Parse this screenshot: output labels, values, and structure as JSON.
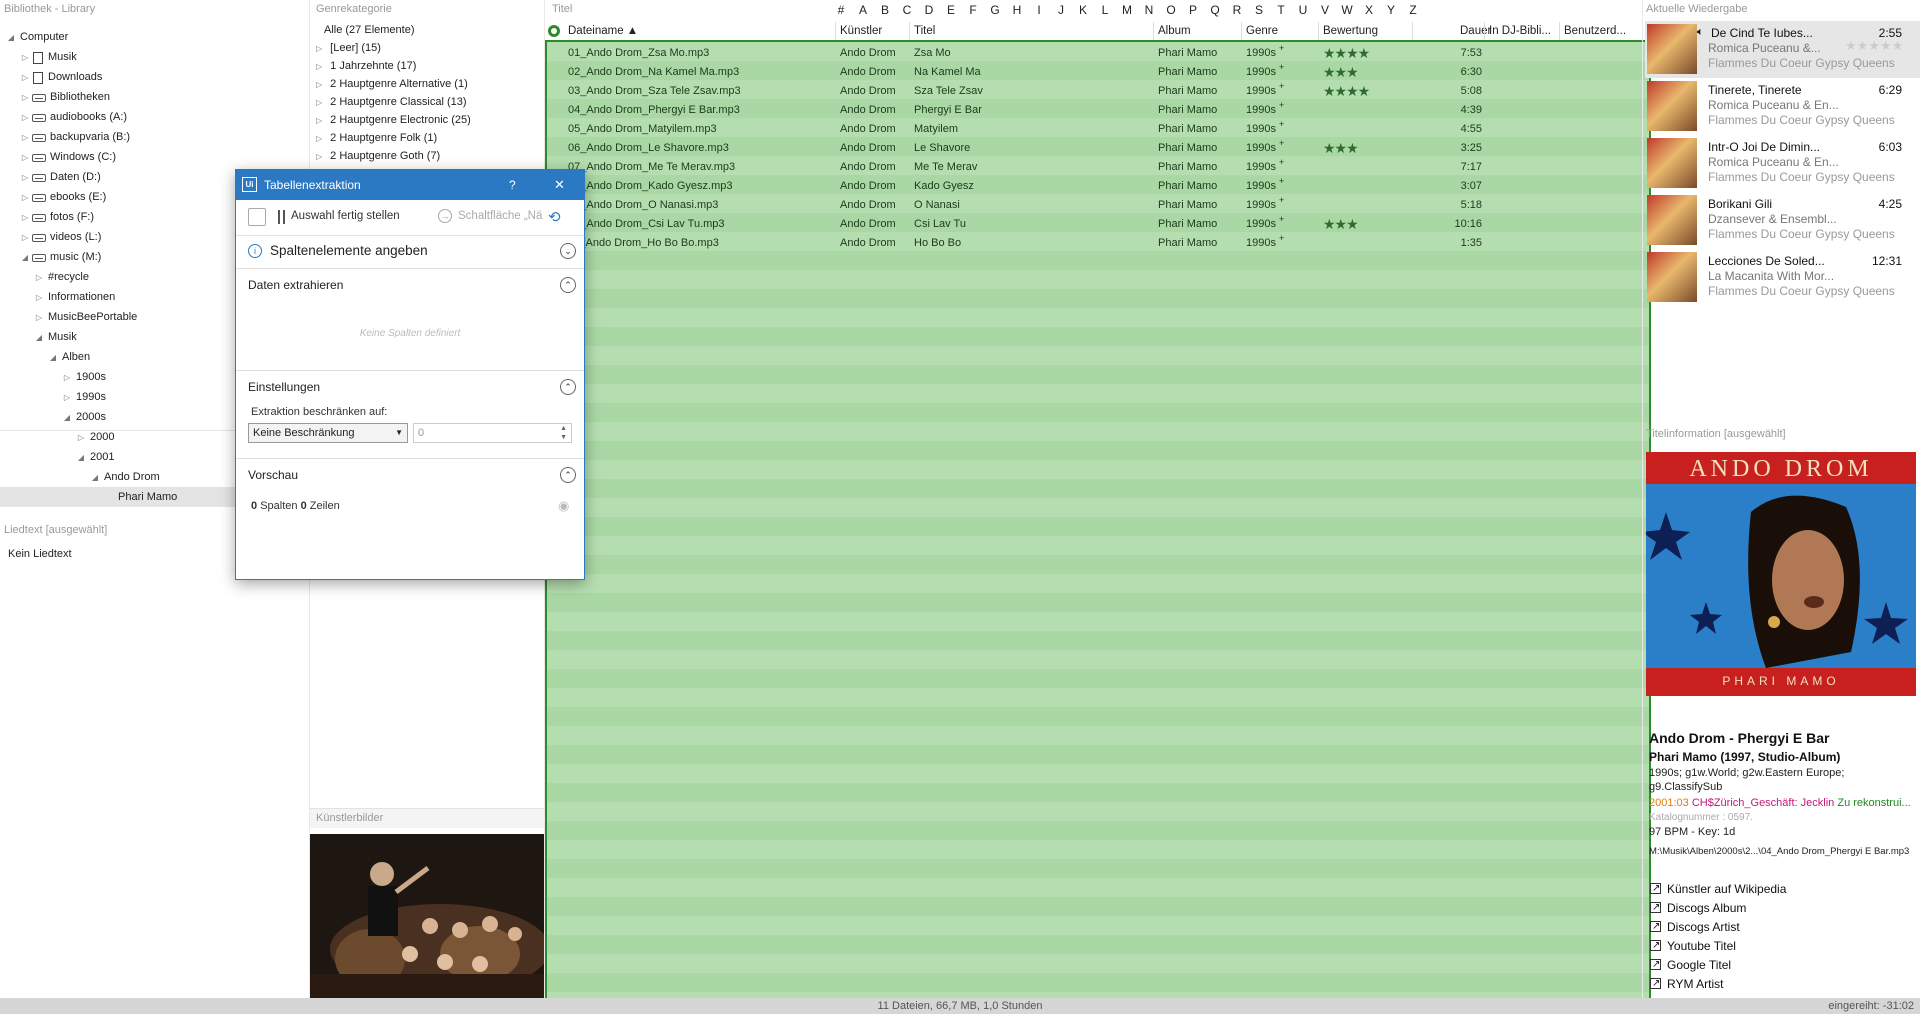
{
  "library": {
    "header": "Bibliothek - Library",
    "tree": [
      {
        "label": "Computer",
        "level": 0,
        "toggle": "◢",
        "icon": "none"
      },
      {
        "label": "Musik",
        "level": 1,
        "toggle": "▷",
        "icon": "folder"
      },
      {
        "label": "Downloads",
        "level": 1,
        "toggle": "▷",
        "icon": "folder"
      },
      {
        "label": "Bibliotheken",
        "level": 1,
        "toggle": "▷",
        "icon": "drive"
      },
      {
        "label": "audiobooks (A:)",
        "level": 1,
        "toggle": "▷",
        "icon": "drive"
      },
      {
        "label": "backupvaria (B:)",
        "level": 1,
        "toggle": "▷",
        "icon": "drive"
      },
      {
        "label": "Windows (C:)",
        "level": 1,
        "toggle": "▷",
        "icon": "drive"
      },
      {
        "label": "Daten (D:)",
        "level": 1,
        "toggle": "▷",
        "icon": "drive"
      },
      {
        "label": "ebooks (E:)",
        "level": 1,
        "toggle": "▷",
        "icon": "drive"
      },
      {
        "label": "fotos (F:)",
        "level": 1,
        "toggle": "▷",
        "icon": "drive"
      },
      {
        "label": "videos (L:)",
        "level": 1,
        "toggle": "▷",
        "icon": "drive"
      },
      {
        "label": "music (M:)",
        "level": 1,
        "toggle": "◢",
        "icon": "drive"
      },
      {
        "label": "#recycle",
        "level": 2,
        "toggle": "▷",
        "icon": "none"
      },
      {
        "label": "Informationen",
        "level": 2,
        "toggle": "▷",
        "icon": "none"
      },
      {
        "label": "MusicBeePortable",
        "level": 2,
        "toggle": "▷",
        "icon": "none"
      },
      {
        "label": "Musik",
        "level": 2,
        "toggle": "◢",
        "icon": "none"
      },
      {
        "label": "Alben",
        "level": 3,
        "toggle": "◢",
        "icon": "none"
      },
      {
        "label": "1900s",
        "level": 4,
        "toggle": "▷",
        "icon": "none"
      },
      {
        "label": "1990s",
        "level": 4,
        "toggle": "▷",
        "icon": "none"
      },
      {
        "label": "2000s",
        "level": 4,
        "toggle": "◢",
        "icon": "none"
      },
      {
        "label": "2000",
        "level": 5,
        "toggle": "▷",
        "icon": "none"
      },
      {
        "label": "2001",
        "level": 5,
        "toggle": "◢",
        "icon": "none"
      },
      {
        "label": "Ando Drom",
        "level": 6,
        "toggle": "◢",
        "icon": "none"
      },
      {
        "label": "Phari Mamo",
        "level": 7,
        "toggle": "",
        "icon": "none",
        "selected": true
      }
    ]
  },
  "lyrics": {
    "header": "Liedtext  [ausgewählt]",
    "text": "Kein Liedtext"
  },
  "genre": {
    "header": "Genrekategorie",
    "items": [
      {
        "label": "Alle  (27 Elemente)",
        "toggle": ""
      },
      {
        "label": "[Leer]  (15)",
        "toggle": "▷"
      },
      {
        "label": "1 Jahrzehnte  (17)",
        "toggle": "▷"
      },
      {
        "label": "2 Hauptgenre Alternative  (1)",
        "toggle": "▷"
      },
      {
        "label": "2 Hauptgenre Classical  (13)",
        "toggle": "▷"
      },
      {
        "label": "2 Hauptgenre Electronic  (25)",
        "toggle": "▷"
      },
      {
        "label": "2 Hauptgenre Folk  (1)",
        "toggle": "▷"
      },
      {
        "label": "2 Hauptgenre Goth  (7)",
        "toggle": "▷"
      }
    ]
  },
  "artist_images": {
    "header": "Künstlerbilder"
  },
  "title_filter": {
    "label": "Titel",
    "letters": [
      "#",
      "A",
      "B",
      "C",
      "D",
      "E",
      "F",
      "G",
      "H",
      "I",
      "J",
      "K",
      "L",
      "M",
      "N",
      "O",
      "P",
      "Q",
      "R",
      "S",
      "T",
      "U",
      "V",
      "W",
      "X",
      "Y",
      "Z"
    ]
  },
  "columns": {
    "filename": "Dateiname ▲",
    "artist": "Künstler",
    "title": "Titel",
    "album": "Album",
    "genre": "Genre",
    "rating": "Bewertung",
    "duration": "Dauer",
    "dj": "In DJ-Bibli...",
    "custom": "Benutzerd..."
  },
  "tracks": [
    {
      "file": "01_Ando Drom_Zsa Mo.mp3",
      "artist": "Ando Drom",
      "title": "Zsa Mo",
      "album": "Phari Mamo",
      "genre": "1990s",
      "rating": "★★★★",
      "duration": "7:53"
    },
    {
      "file": "02_Ando Drom_Na Kamel Ma.mp3",
      "artist": "Ando Drom",
      "title": "Na Kamel Ma",
      "album": "Phari Mamo",
      "genre": "1990s",
      "rating": "★★★",
      "duration": "6:30"
    },
    {
      "file": "03_Ando Drom_Sza Tele Zsav.mp3",
      "artist": "Ando Drom",
      "title": "Sza Tele Zsav",
      "album": "Phari Mamo",
      "genre": "1990s",
      "rating": "★★★★",
      "duration": "5:08"
    },
    {
      "file": "04_Ando Drom_Phergyi E Bar.mp3",
      "artist": "Ando Drom",
      "title": "Phergyi E Bar",
      "album": "Phari Mamo",
      "genre": "1990s",
      "rating": "",
      "duration": "4:39"
    },
    {
      "file": "05_Ando Drom_Matyilem.mp3",
      "artist": "Ando Drom",
      "title": "Matyilem",
      "album": "Phari Mamo",
      "genre": "1990s",
      "rating": "",
      "duration": "4:55"
    },
    {
      "file": "06_Ando Drom_Le Shavore.mp3",
      "artist": "Ando Drom",
      "title": "Le Shavore",
      "album": "Phari Mamo",
      "genre": "1990s",
      "rating": "★★★",
      "duration": "3:25"
    },
    {
      "file": "07_Ando Drom_Me Te Merav.mp3",
      "artist": "Ando Drom",
      "title": "Me Te Merav",
      "album": "Phari Mamo",
      "genre": "1990s",
      "rating": "",
      "duration": "7:17"
    },
    {
      "file": "08_Ando Drom_Kado Gyesz.mp3",
      "artist": "Ando Drom",
      "title": "Kado Gyesz",
      "album": "Phari Mamo",
      "genre": "1990s",
      "rating": "",
      "duration": "3:07"
    },
    {
      "file": "09_Ando Drom_O Nanasi.mp3",
      "artist": "Ando Drom",
      "title": "O Nanasi",
      "album": "Phari Mamo",
      "genre": "1990s",
      "rating": "",
      "duration": "5:18"
    },
    {
      "file": "10_Ando Drom_Csi Lav Tu.mp3",
      "artist": "Ando Drom",
      "title": "Csi Lav Tu",
      "album": "Phari Mamo",
      "genre": "1990s",
      "rating": "★★★",
      "duration": "10:16"
    },
    {
      "file": "11_Ando Drom_Ho Bo Bo.mp3",
      "artist": "Ando Drom",
      "title": "Ho Bo Bo",
      "album": "Phari Mamo",
      "genre": "1990s",
      "rating": "",
      "duration": "1:35"
    }
  ],
  "now_playing": {
    "header": "Aktuelle Wiedergabe",
    "items": [
      {
        "title": "De Cind Te Iubes...",
        "duration": "2:55",
        "artist": "Romica Puceanu &...",
        "album": "Flammes Du Coeur Gypsy Queens",
        "active": true
      },
      {
        "title": "Tinerete, Tinerete",
        "duration": "6:29",
        "artist": "Romica Puceanu & En...",
        "album": "Flammes Du Coeur Gypsy Queens"
      },
      {
        "title": "Intr-O Joi De Dimin...",
        "duration": "6:03",
        "artist": "Romica Puceanu & En...",
        "album": "Flammes Du Coeur Gypsy Queens"
      },
      {
        "title": "Borikani Gili",
        "duration": "4:25",
        "artist": "Dzansever & Ensembl...",
        "album": "Flammes Du Coeur Gypsy Queens"
      },
      {
        "title": "Lecciones De Soled...",
        "duration": "12:31",
        "artist": "La Macanita With Mor...",
        "album": "Flammes Du Coeur Gypsy Queens"
      }
    ]
  },
  "track_info": {
    "header": "Titelinformation  [ausgewählt]",
    "cover_artist": "ANDO DROM",
    "cover_album": "PHARI MAMO",
    "heading": "Ando Drom - Phergyi E Bar",
    "album_line": "Phari Mamo (1997, Studio-Album)",
    "genres": "1990s; g1w.World; g2w.Eastern Europe; g9.ClassifySub",
    "meta_date": "2001:03",
    "meta_loc": "CH$Zürich_Geschäft: Jecklin",
    "meta_note": "Zu rekonstrui...",
    "catalog": "Katalognummer : 0597.",
    "bpm": "97 BPM - Key: 1d",
    "path": "M:\\Musik\\Alben\\2000s\\2...\\04_Ando Drom_Phergyi E Bar.mp3",
    "links": [
      "Künstler auf Wikipedia",
      "Discogs Album",
      "Discogs Artist",
      "Youtube Titel",
      "Google Titel",
      "RYM Artist"
    ]
  },
  "dialog": {
    "title": "Tabellenextraktion",
    "help": "?",
    "close": "✕",
    "finish_label": "Auswahl fertig stellen",
    "button_label": "Schaltfläche „Nä",
    "section1": "Spaltenelemente angeben",
    "section2": "Daten extrahieren",
    "empty": "Keine Spalten definiert",
    "section3": "Einstellungen",
    "limit_label": "Extraktion beschränken auf:",
    "limit_value": "Keine Beschränkung",
    "limit_count": "0",
    "section4": "Vorschau",
    "cols": "0",
    "cols_label": "Spalten",
    "rows": "0",
    "rows_label": "Zeilen"
  },
  "status": {
    "summary": "11 Dateien, 66,7 MB, 1,0 Stunden",
    "queue": "eingereiht: -31:02"
  },
  "colors": {
    "accent": "#2b79c2",
    "grid_green": "#b5deb0",
    "grid_border": "#2d8a2d",
    "star": "#2f6b2f"
  }
}
